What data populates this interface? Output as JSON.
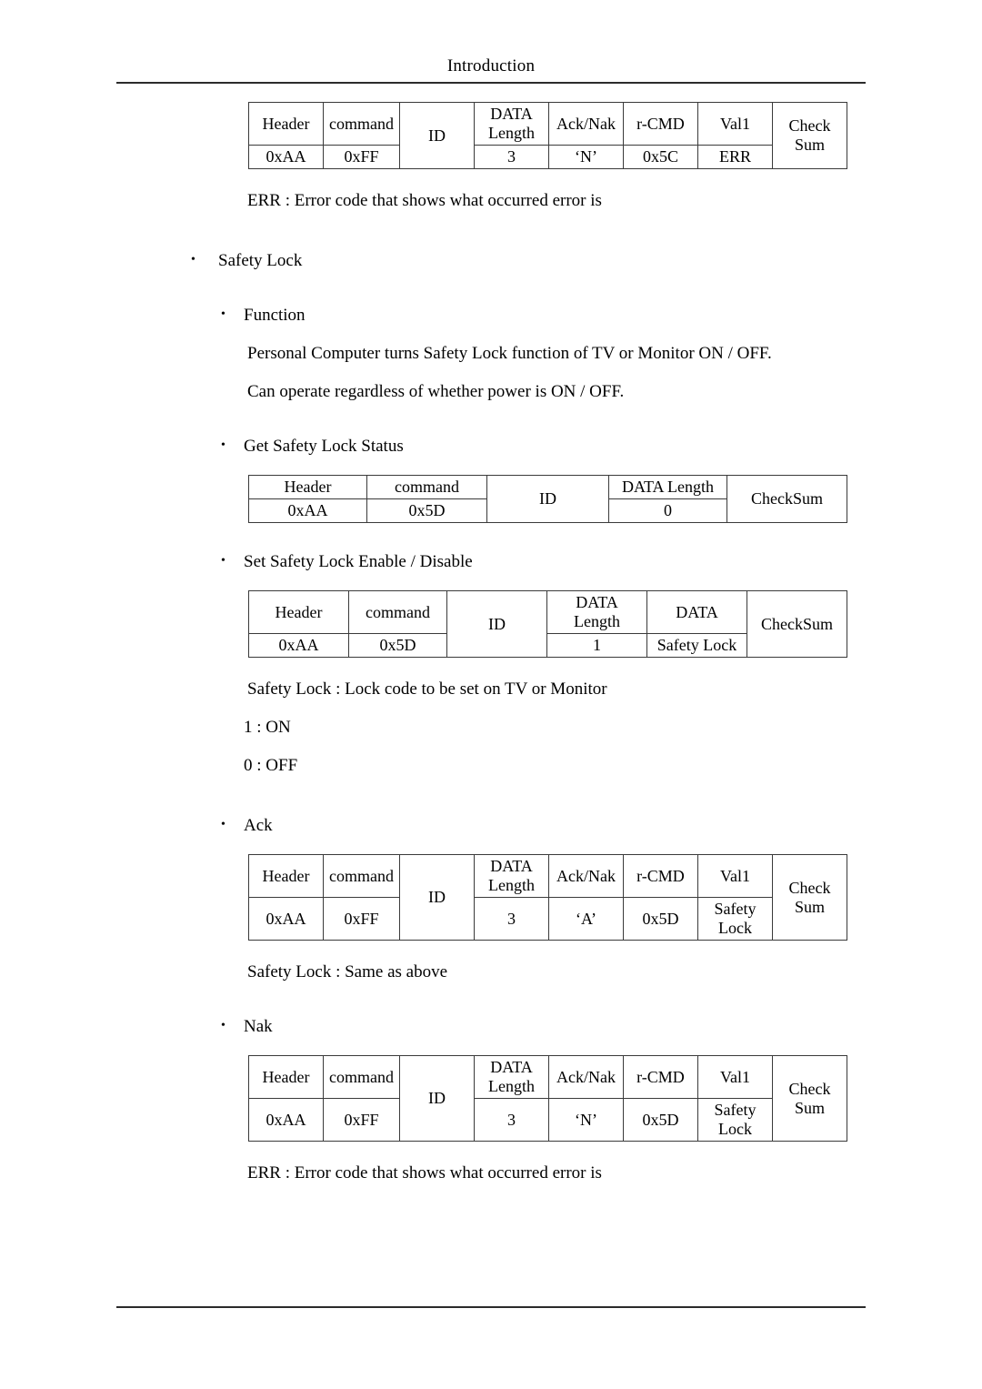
{
  "header": {
    "title": "Introduction"
  },
  "sections": {
    "nak_top": {
      "table": {
        "headers": [
          "Header",
          "command",
          "ID",
          "DATA Length",
          "Ack/Nak",
          "r-CMD",
          "Val1",
          "Check Sum"
        ],
        "values": [
          "0xAA",
          "0xFF",
          "",
          "3",
          "‘N’",
          "0x5C",
          "ERR",
          ""
        ]
      },
      "note": "ERR : Error code that shows what occurred error is"
    },
    "safety_lock": {
      "title": "Safety Lock",
      "function_label": "Function",
      "function_lines": [
        "Personal Computer turns Safety Lock function of TV or Monitor ON / OFF.",
        "Can operate regardless of whether power is ON / OFF."
      ]
    },
    "get_status": {
      "title": "Get Safety Lock Status",
      "table": {
        "headers": [
          "Header",
          "command",
          "ID",
          "DATA Length",
          "CheckSum"
        ],
        "values": [
          "0xAA",
          "0x5D",
          "",
          "0",
          ""
        ]
      }
    },
    "set_enable": {
      "title": "Set Safety Lock Enable / Disable",
      "table": {
        "headers": [
          "Header",
          "command",
          "ID",
          "DATA Length",
          "DATA",
          "CheckSum"
        ],
        "values": [
          "0xAA",
          "0x5D",
          "",
          "1",
          "Safety Lock",
          ""
        ]
      },
      "note": "Safety Lock : Lock code to be set on TV or Monitor",
      "codes": [
        "1 : ON",
        "0 : OFF"
      ]
    },
    "ack": {
      "title": "Ack",
      "table": {
        "headers": [
          "Header",
          "command",
          "ID",
          "DATA Length",
          "Ack/Nak",
          "r-CMD",
          "Val1",
          "Check Sum"
        ],
        "values": [
          "0xAA",
          "0xFF",
          "",
          "3",
          "‘A’",
          "0x5D",
          "Safety Lock",
          ""
        ]
      },
      "note": "Safety Lock : Same as above"
    },
    "nak": {
      "title": "Nak",
      "table": {
        "headers": [
          "Header",
          "command",
          "ID",
          "DATA Length",
          "Ack/Nak",
          "r-CMD",
          "Val1",
          "Check Sum"
        ],
        "values": [
          "0xAA",
          "0xFF",
          "",
          "3",
          "‘N’",
          "0x5D",
          "Safety Lock",
          ""
        ]
      },
      "note": "ERR : Error code that shows what occurred error is"
    }
  }
}
